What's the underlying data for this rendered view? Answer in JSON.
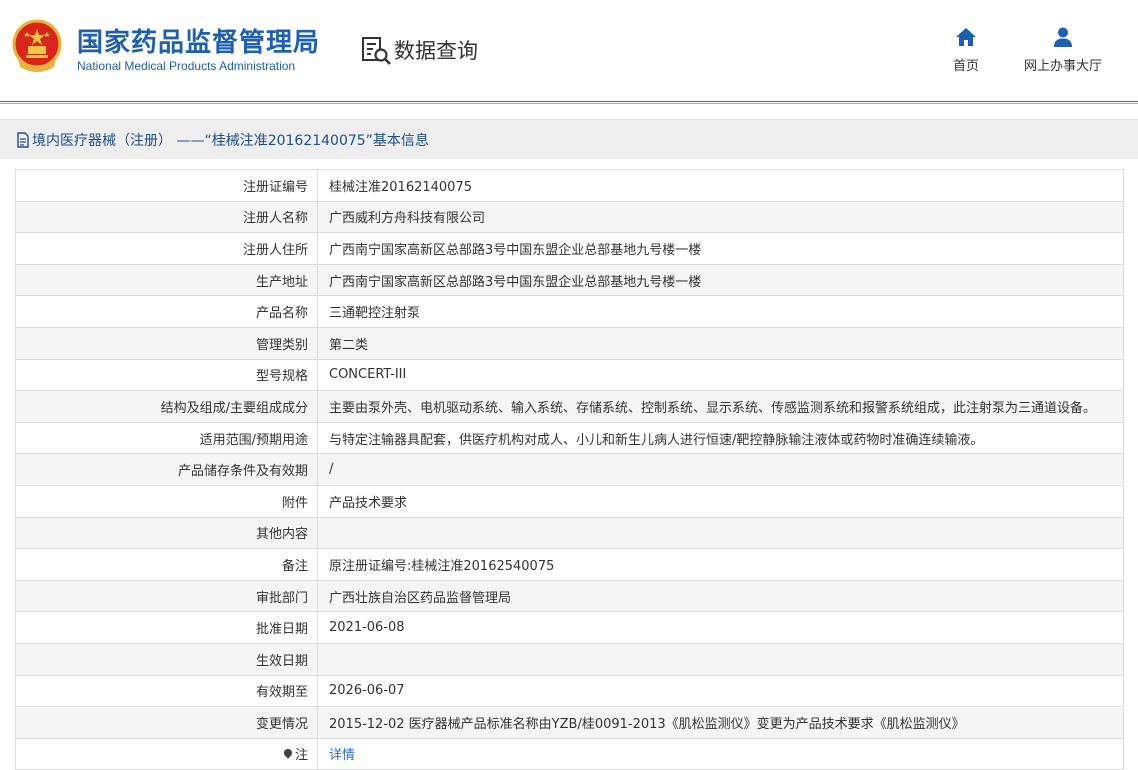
{
  "header": {
    "site_title_cn": "国家药品监督管理局",
    "site_title_en": "National Medical Products Administration",
    "search_label": "数据查询",
    "nav": [
      {
        "label": "首页",
        "icon": "home-icon"
      },
      {
        "label": "网上办事大厅",
        "icon": "user-icon"
      }
    ],
    "emblem": "national-emblem-icon"
  },
  "colors": {
    "brand_blue": "#1d5fb0",
    "title_blue": "#1d4f8f",
    "link_blue": "#2a6fc4",
    "title_bar_bg": "#eeeeee",
    "row_alt_bg": "#f5f5f5"
  },
  "title_bar": {
    "text": "境内医疗器械（注册） ——“桂械注准20162140075”基本信息",
    "icon": "document-icon"
  },
  "rows": [
    {
      "label": "注册证编号",
      "value": "桂械注准20162140075"
    },
    {
      "label": "注册人名称",
      "value": "广西威利方舟科技有限公司"
    },
    {
      "label": "注册人住所",
      "value": "广西南宁国家高新区总部路3号中国东盟企业总部基地九号楼一楼"
    },
    {
      "label": "生产地址",
      "value": "广西南宁国家高新区总部路3号中国东盟企业总部基地九号楼一楼"
    },
    {
      "label": "产品名称",
      "value": "三通靶控注射泵"
    },
    {
      "label": "管理类别",
      "value": "第二类"
    },
    {
      "label": "型号规格",
      "value": "CONCERT-III"
    },
    {
      "label": "结构及组成/主要组成成分",
      "value": "主要由泵外壳、电机驱动系统、输入系统、存储系统、控制系统、显示系统、传感监测系统和报警系统组成，此注射泵为三通道设备。"
    },
    {
      "label": "适用范围/预期用途",
      "value": "与特定注输器具配套，供医疗机构对成人、小儿和新生儿病人进行恒速/靶控静脉输注液体或药物时准确连续输液。"
    },
    {
      "label": "产品储存条件及有效期",
      "value": "/"
    },
    {
      "label": "附件",
      "value": "产品技术要求"
    },
    {
      "label": "其他内容",
      "value": ""
    },
    {
      "label": "备注",
      "value": "原注册证编号:桂械注准20162540075"
    },
    {
      "label": "审批部门",
      "value": "广西壮族自治区药品监督管理局"
    },
    {
      "label": "批准日期",
      "value": "2021-06-08"
    },
    {
      "label": "生效日期",
      "value": ""
    },
    {
      "label": "有效期至",
      "value": "2026-06-07"
    },
    {
      "label": "变更情况",
      "value": "2015-12-02 医疗器械产品标准名称由YZB/桂0091-2013《肌松监测仪》变更为产品技术要求《肌松监测仪》"
    }
  ],
  "note_row": {
    "label": "注",
    "link_text": "详情",
    "icon": "note-icon"
  }
}
